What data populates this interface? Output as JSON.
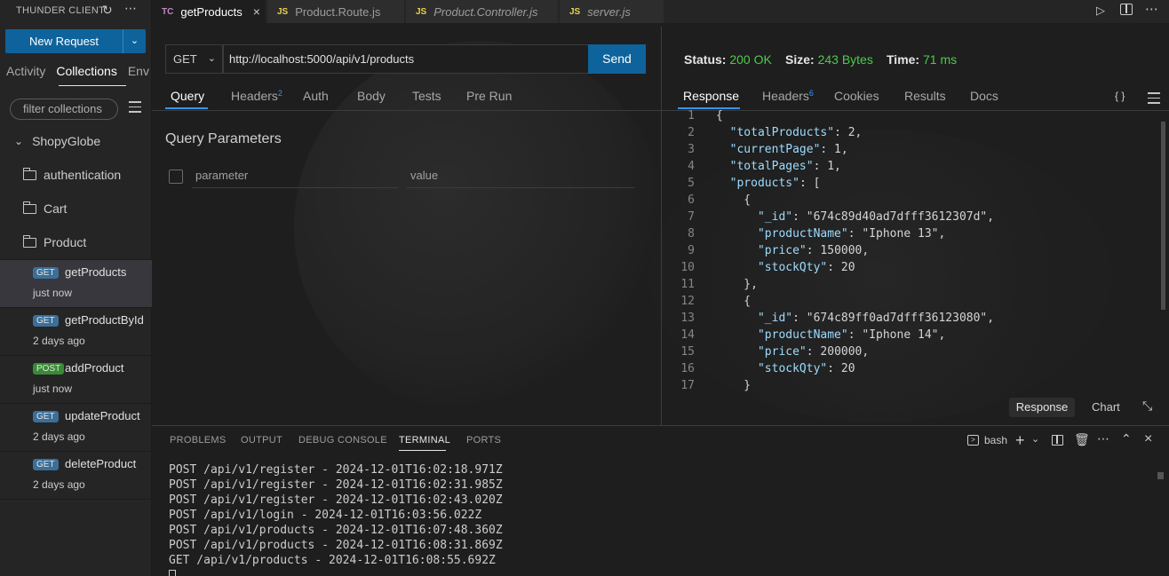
{
  "sidebar": {
    "title": "THUNDER CLIENT",
    "new_request": "New Request",
    "tabs": [
      {
        "label": "Activity"
      },
      {
        "label": "Collections"
      },
      {
        "label": "Env"
      }
    ],
    "filter_placeholder": "filter collections",
    "collection": "ShopyGlobe",
    "folders": [
      {
        "label": "authentication"
      },
      {
        "label": "Cart"
      },
      {
        "label": "Product"
      }
    ],
    "requests": [
      {
        "method": "GET",
        "name": "getProducts",
        "time": "just now"
      },
      {
        "method": "GET",
        "name": "getProductById",
        "time": "2 days ago"
      },
      {
        "method": "POST",
        "name": "addProduct",
        "time": "just now"
      },
      {
        "method": "GET",
        "name": "updateProduct",
        "time": "2 days ago"
      },
      {
        "method": "GET",
        "name": "deleteProduct",
        "time": "2 days ago"
      }
    ]
  },
  "editor_tabs": [
    {
      "icon": "TC",
      "label": "getProducts"
    },
    {
      "icon": "JS",
      "label": "Product.Route.js"
    },
    {
      "icon": "JS",
      "label": "Product.Controller.js"
    },
    {
      "icon": "JS",
      "label": "server.js"
    }
  ],
  "request": {
    "method": "GET",
    "url": "http://localhost:5000/api/v1/products",
    "send": "Send",
    "tabs": [
      {
        "label": "Query"
      },
      {
        "label": "Headers",
        "count": "2"
      },
      {
        "label": "Auth"
      },
      {
        "label": "Body"
      },
      {
        "label": "Tests"
      },
      {
        "label": "Pre Run"
      }
    ],
    "query_title": "Query Parameters",
    "param_placeholder": "parameter",
    "value_placeholder": "value"
  },
  "response": {
    "status_label": "Status:",
    "status": "200 OK",
    "size_label": "Size:",
    "size": "243 Bytes",
    "time_label": "Time:",
    "time": "71 ms",
    "tabs": [
      {
        "label": "Response"
      },
      {
        "label": "Headers",
        "count": "6"
      },
      {
        "label": "Cookies"
      },
      {
        "label": "Results"
      },
      {
        "label": "Docs"
      }
    ],
    "braces_icon": "{ }",
    "view_response": "Response",
    "view_chart": "Chart",
    "lines": [
      "{",
      "  \"totalProducts\": 2,",
      "  \"currentPage\": 1,",
      "  \"totalPages\": 1,",
      "  \"products\": [",
      "    {",
      "      \"_id\": \"674c89d40ad7dfff3612307d\",",
      "      \"productName\": \"Iphone 13\",",
      "      \"price\": 150000,",
      "      \"stockQty\": 20",
      "    },",
      "    {",
      "      \"_id\": \"674c89ff0ad7dfff36123080\",",
      "      \"productName\": \"Iphone 14\",",
      "      \"price\": 200000,",
      "      \"stockQty\": 20",
      "    }"
    ]
  },
  "panel": {
    "tabs": [
      "PROBLEMS",
      "OUTPUT",
      "DEBUG CONSOLE",
      "TERMINAL",
      "PORTS"
    ],
    "shell": "bash",
    "terminal_lines": [
      "POST /api/v1/register - 2024-12-01T16:02:18.971Z",
      "POST /api/v1/register - 2024-12-01T16:02:31.985Z",
      "POST /api/v1/register - 2024-12-01T16:02:43.020Z",
      "POST /api/v1/login - 2024-12-01T16:03:56.022Z",
      "POST /api/v1/products - 2024-12-01T16:07:48.360Z",
      "POST /api/v1/products - 2024-12-01T16:08:31.869Z",
      "GET /api/v1/products - 2024-12-01T16:08:55.692Z"
    ]
  },
  "colors": {
    "accent": "#0e639c",
    "status_ok": "#4ec94e",
    "tab_underline": "#3794ff"
  }
}
